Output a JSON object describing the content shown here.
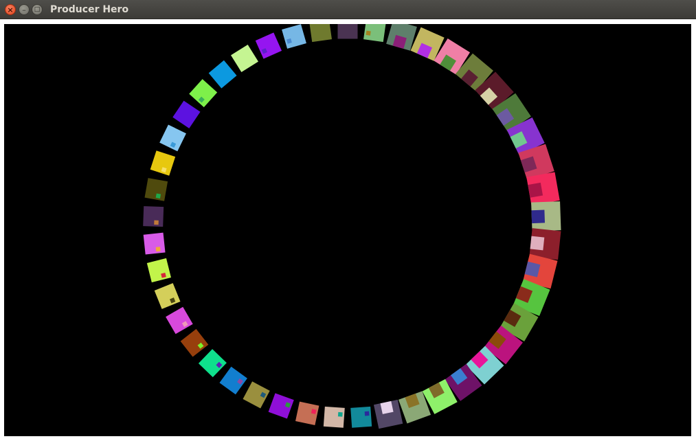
{
  "window": {
    "title": "Producer Hero",
    "close_glyph": "×",
    "minimize_glyph": "–",
    "maximize_glyph": "□"
  },
  "canvas": {
    "background": "#000000",
    "tiles": [
      {
        "color": "#4a3352",
        "accent": null
      },
      {
        "color": "#7bbf7a",
        "accent": "#a3821f"
      },
      {
        "color": "#5e7f6b",
        "accent": "#8b1f78"
      },
      {
        "color": "#c2b660",
        "accent": "#b12ee3"
      },
      {
        "color": "#ef7fa6",
        "accent": "#4f8f3a"
      },
      {
        "color": "#6d7d3b",
        "accent": "#5a2032"
      },
      {
        "color": "#5b1b2a",
        "accent": "#d6d1a6"
      },
      {
        "color": "#4e7a3a",
        "accent": "#6c5aa1"
      },
      {
        "color": "#8733cf",
        "accent": "#72c78e"
      },
      {
        "color": "#d0395e",
        "accent": "#7e2858"
      },
      {
        "color": "#f32a5d",
        "accent": "#a91447"
      },
      {
        "color": "#a8b986",
        "accent": "#2f2a8c"
      },
      {
        "color": "#8c1f2b",
        "accent": "#dfaebd"
      },
      {
        "color": "#e3453c",
        "accent": "#5a58a6"
      },
      {
        "color": "#56c43f",
        "accent": "#8a2b1b"
      },
      {
        "color": "#6aa13b",
        "accent": "#5a2a0f"
      },
      {
        "color": "#bb137e",
        "accent": "#8a4a0a"
      },
      {
        "color": "#7ed0d1",
        "accent": "#e8159a"
      },
      {
        "color": "#6e1267",
        "accent": "#3a7fd0"
      },
      {
        "color": "#8ef06a",
        "accent": "#7f6b2a"
      },
      {
        "color": "#8ba876",
        "accent": "#8a7327"
      },
      {
        "color": "#524766",
        "accent": "#e6d3ea"
      },
      {
        "color": "#128a9b",
        "accent": "#2a2a9c"
      },
      {
        "color": "#d2b7a7",
        "accent": "#10a58f"
      },
      {
        "color": "#c56f55",
        "accent": "#f0205a"
      },
      {
        "color": "#8f0fd8",
        "accent": "#2c9a3f"
      },
      {
        "color": "#9a8f3e",
        "accent": "#1f5b7a"
      },
      {
        "color": "#127ecf",
        "accent": "#8a4aa8"
      },
      {
        "color": "#0fe08c",
        "accent": "#5a22b5"
      },
      {
        "color": "#973f0c",
        "accent": "#7df02a"
      },
      {
        "color": "#d849dc",
        "accent": "#ef98b8"
      },
      {
        "color": "#d4cf5a",
        "accent": "#4a4610"
      },
      {
        "color": "#c2f44a",
        "accent": "#d42a3a"
      },
      {
        "color": "#d85be8",
        "accent": "#f0a83a"
      },
      {
        "color": "#492b58",
        "accent": "#c07a3a"
      },
      {
        "color": "#4f4a0d",
        "accent": "#1fa84a"
      },
      {
        "color": "#e7c80f",
        "accent": "#f7e06a"
      },
      {
        "color": "#86c6f0",
        "accent": "#3a9ad8"
      },
      {
        "color": "#5c12e0",
        "accent": null
      },
      {
        "color": "#7ef04a",
        "accent": "#3ab05a"
      },
      {
        "color": "#0c99e0",
        "accent": null
      },
      {
        "color": "#c5f592",
        "accent": null
      },
      {
        "color": "#9515f0",
        "accent": "#5a22c8"
      },
      {
        "color": "#76b7e5",
        "accent": "#4a8ad0"
      },
      {
        "color": "#6f7a2e",
        "accent": null
      }
    ]
  }
}
